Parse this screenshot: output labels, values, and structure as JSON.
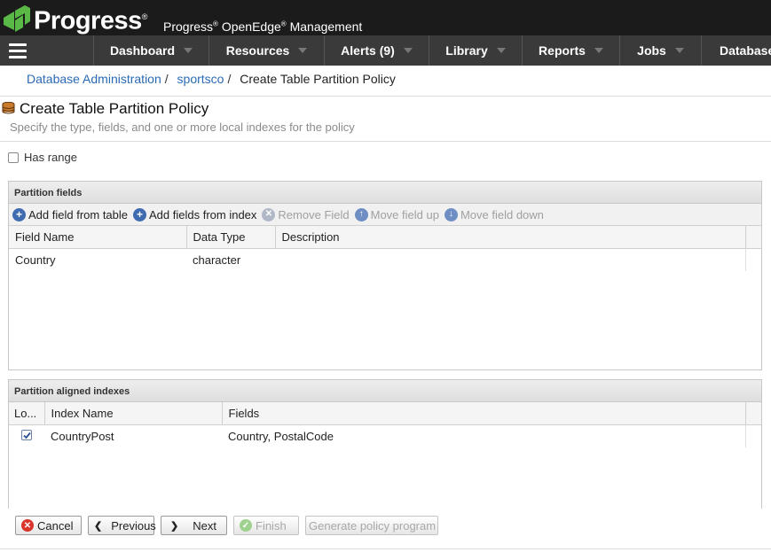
{
  "header": {
    "brand": "Progress",
    "brand_sup": "®",
    "app_title_1": "Progress",
    "app_title_2": "OpenEdge",
    "app_title_3": "Management",
    "reg": "®"
  },
  "nav": {
    "items": [
      {
        "label": "Dashboard"
      },
      {
        "label": "Resources"
      },
      {
        "label": "Alerts (9)"
      },
      {
        "label": "Library"
      },
      {
        "label": "Reports"
      },
      {
        "label": "Jobs"
      },
      {
        "label": "Databases"
      }
    ]
  },
  "breadcrumb": {
    "item1": "Database Administration",
    "item2": "sportsco",
    "current": "Create Table Partition Policy",
    "sep": "/"
  },
  "page": {
    "title": "Create Table Partition Policy",
    "subtitle": "Specify the type, fields, and one or more local indexes for the policy",
    "has_range_label": "Has range",
    "has_range_checked": false
  },
  "partition_fields": {
    "title": "Partition fields",
    "toolbar": {
      "add_from_table": "Add field from table",
      "add_from_index": "Add fields from index",
      "remove": "Remove Field",
      "move_up": "Move field up",
      "move_down": "Move field down"
    },
    "columns": [
      "Field Name",
      "Data Type",
      "Description"
    ],
    "rows": [
      {
        "field_name": "Country",
        "data_type": "character",
        "description": ""
      }
    ]
  },
  "aligned_indexes": {
    "title": "Partition aligned indexes",
    "columns": [
      "Lo...",
      "Index Name",
      "Fields"
    ],
    "rows": [
      {
        "local": true,
        "index_name": "CountryPost",
        "fields": "Country, PostalCode"
      }
    ]
  },
  "buttons": {
    "cancel": "Cancel",
    "previous": "Previous",
    "next": "Next",
    "finish": "Finish",
    "generate": "Generate policy program"
  },
  "colors": {
    "topbar": "#1b1b1b",
    "navbar": "#3a3a3a",
    "brand_green": "#5ab847",
    "link": "#2a6ab3",
    "icon_blue": "#3f6bb0",
    "cancel_red": "#d9342b",
    "finish_green": "#7cc26a"
  }
}
